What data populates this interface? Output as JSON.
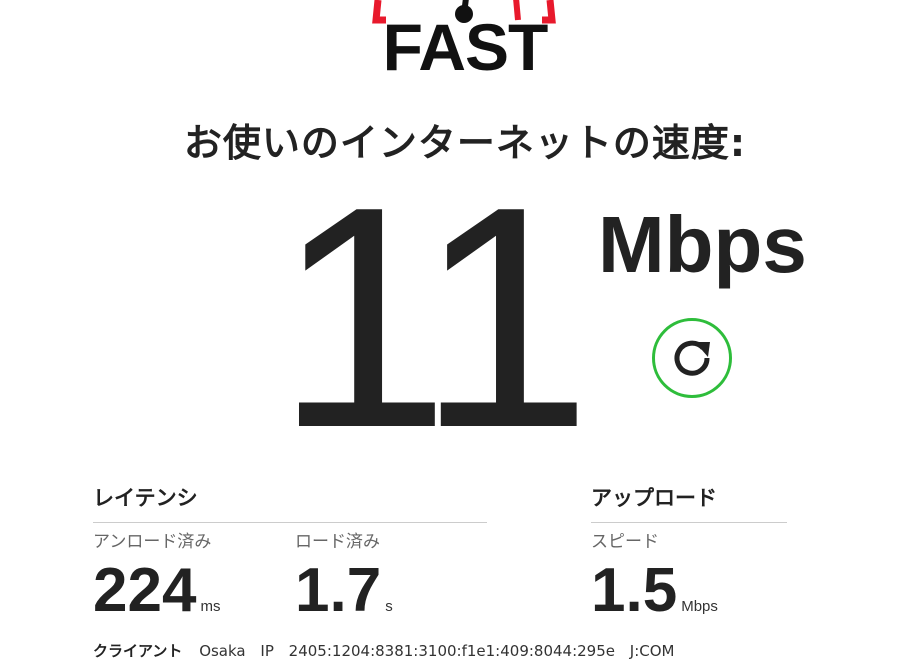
{
  "logo": {
    "text": "FAST",
    "accent": "#e8192c"
  },
  "headline": "お使いのインターネットの速度:",
  "speed": {
    "value": "11",
    "units": "Mbps"
  },
  "refresh": {
    "icon": "refresh-icon",
    "color": "#2ebd3b"
  },
  "latency": {
    "title": "レイテンシ",
    "unloaded": {
      "label": "アンロード済み",
      "value": "224",
      "unit": "ms"
    },
    "loaded": {
      "label": "ロード済み",
      "value": "1.7",
      "unit": "s"
    }
  },
  "upload": {
    "title": "アップロード",
    "speed": {
      "label": "スピード",
      "value": "1.5",
      "unit": "Mbps"
    }
  },
  "client": {
    "label": "クライアント",
    "city": "Osaka",
    "ip_label": "IP",
    "ip": "2405:1204:8381:3100:f1e1:409:8044:295e",
    "isp": "J:COM"
  }
}
